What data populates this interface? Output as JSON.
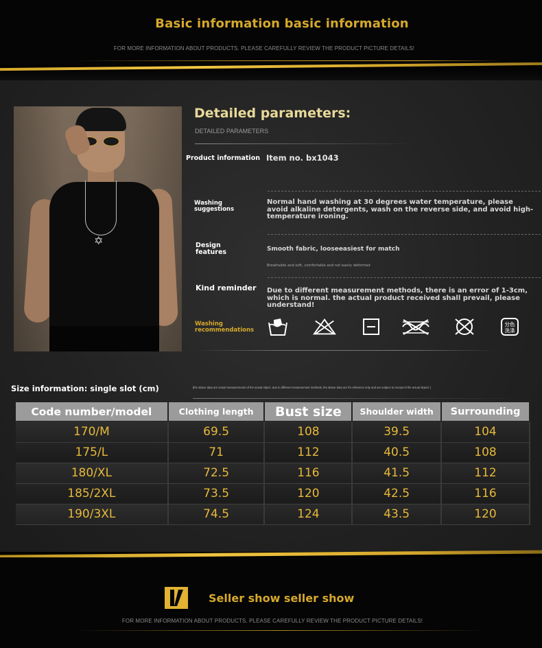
{
  "header": {
    "title": "Basic information basic information",
    "subtitle": "FOR MORE INFORMATION ABOUT PRODUCTS. PLEASE CAREFULLY REVIEW THE PRODUCT PICTURE DETAILS!"
  },
  "params": {
    "title": "Detailed parameters:",
    "subtitle": "DETAILED PARAMETERS",
    "rows": {
      "product_label": "Product information",
      "product_value": "Item no. bx1043",
      "washing_label_1": "Washing",
      "washing_label_2": "suggestions",
      "washing_value": "Normal hand washing at 30 degrees water temperature, please avoid alkaline detergents, wash on the reverse side, and avoid high-temperature ironing.",
      "design_label_1": "Design",
      "design_label_2": "features",
      "design_value": "Smooth fabric, looseeasiest for match",
      "design_value_sub": "Breathable and soft, comfortable and not easily deformed",
      "reminder_label": "Kind reminder",
      "reminder_value": "Due to different measurement methods, there is an error of 1-3cm, which is normal. the actual product received shall prevail, please understand!",
      "wash_rec_label_1": "Washing",
      "wash_rec_label_2": "recommendations"
    },
    "wash_icons": [
      "hand-wash-icon",
      "do-not-bleach-icon",
      "tumble-dry-icon",
      "do-not-wring-icon",
      "do-not-dry-clean-icon",
      "separate-wash-icon"
    ],
    "separate_wash_text": "分色洗涤"
  },
  "size": {
    "title": "Size information: single slot (cm)",
    "note": "[the above data are actual measurements of the actual object. due to different measurement methods, the above data are for reference only and are subject to receipt of the actual object! ]",
    "headers": [
      "Code number/model",
      "Clothing length",
      "Bust size",
      "Shoulder width",
      "Surrounding"
    ],
    "rows": [
      [
        "170/M",
        "69.5",
        "108",
        "39.5",
        "104"
      ],
      [
        "175/L",
        "71",
        "112",
        "40.5",
        "108"
      ],
      [
        "180/XL",
        "72.5",
        "116",
        "41.5",
        "112"
      ],
      [
        "185/2XL",
        "73.5",
        "120",
        "42.5",
        "116"
      ],
      [
        "190/3XL",
        "74.5",
        "124",
        "43.5",
        "120"
      ]
    ]
  },
  "footer": {
    "title": "Seller show seller show",
    "subtitle": "FOR MORE INFORMATION ABOUT PRODUCTS. PLEASE CAREFULLY REVIEW THE PRODUCT PICTURE DETAILS!"
  },
  "colors": {
    "gold": "#d6a92c",
    "table_header": "#9b9b9b",
    "table_value": "#e8b93a",
    "panel": "#232323"
  }
}
